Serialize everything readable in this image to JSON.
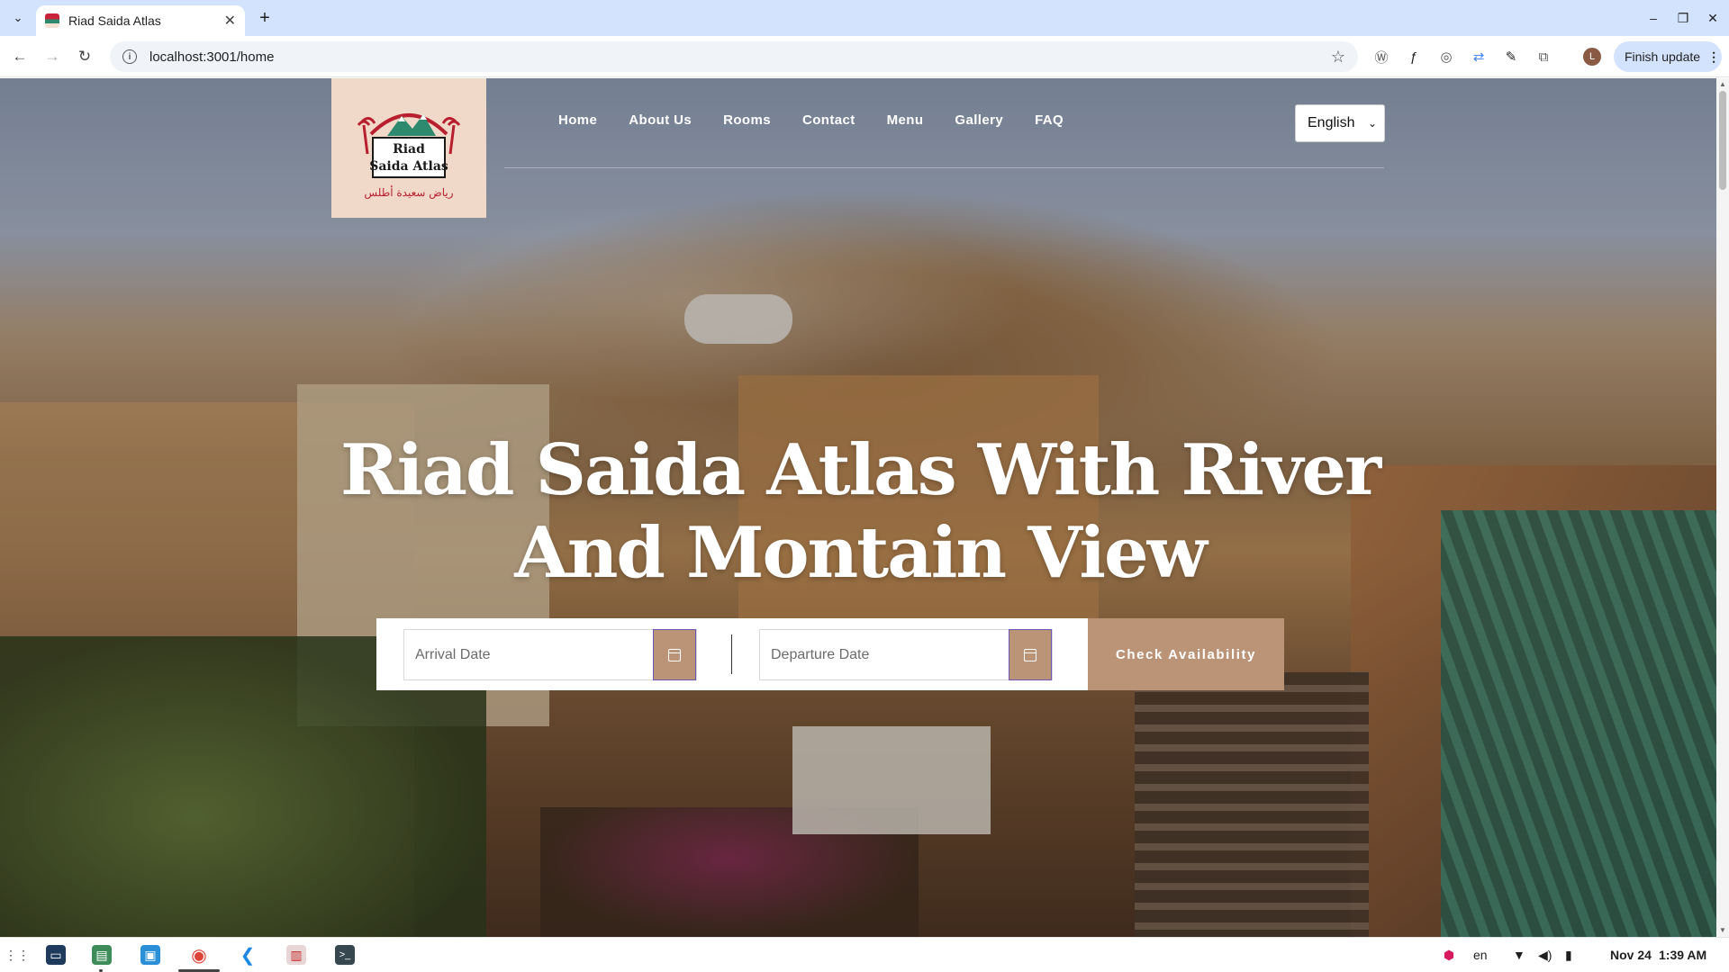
{
  "browser": {
    "tab_title": "Riad Saida Atlas",
    "tab_close": "✕",
    "new_tab": "+",
    "url": "localhost:3001/home",
    "update_button": "Finish update",
    "profile_initial": "L"
  },
  "site": {
    "logo": {
      "line1": "Riad",
      "line2": "Saida Atlas",
      "arabic": "رياض سعيدة أطلس",
      "colors": {
        "background": "#f1d9c9",
        "red": "#b81f2e",
        "teal": "#2d8a6e"
      }
    },
    "nav": {
      "items": [
        "Home",
        "About Us",
        "Rooms",
        "Contact",
        "Menu",
        "Gallery",
        "FAQ"
      ]
    },
    "language": {
      "selected": "English"
    },
    "hero": {
      "title": "Riad Saida Atlas With River And Montain View"
    },
    "booking": {
      "arrival_placeholder": "Arrival Date",
      "departure_placeholder": "Departure Date",
      "check_button": "Check Availability",
      "accent_color": "#bb9478"
    }
  },
  "taskbar": {
    "language": "en",
    "date": "Nov 24",
    "time": "1:39 AM"
  }
}
